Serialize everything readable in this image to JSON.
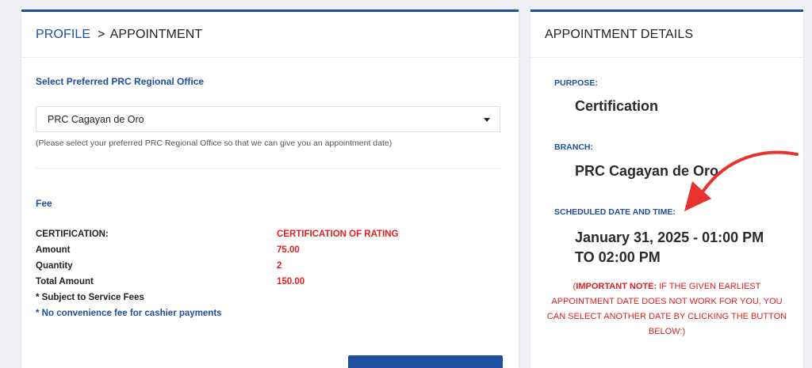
{
  "profile_card": {
    "breadcrumb": {
      "profile": "PROFILE",
      "separator": ">",
      "current": "APPOINTMENT"
    },
    "office_select": {
      "title": "Select Preferred PRC Regional Office",
      "selected": "PRC Cagayan de Oro",
      "help": "(Please select your preferred PRC Regional Office so that we can give you an appointment date)"
    },
    "fee": {
      "title": "Fee",
      "rows": [
        {
          "label": "CERTIFICATION:",
          "value": "CERTIFICATION OF RATING"
        },
        {
          "label": "Amount",
          "value": "75.00"
        },
        {
          "label": "Quantity",
          "value": "2"
        },
        {
          "label": "Total Amount",
          "value": "150.00"
        }
      ],
      "service_fee_note": "* Subject to Service Fees",
      "cashier_note": "* No convenience fee for cashier payments"
    }
  },
  "details_card": {
    "title": "APPOINTMENT DETAILS",
    "purpose_label": "PURPOSE:",
    "purpose_value": "Certification",
    "branch_label": "BRANCH:",
    "branch_value": "PRC Cagayan de Oro",
    "schedule_label": "SCHEDULED DATE AND TIME:",
    "schedule_value": "January 31, 2025 - 01:00 PM TO 02:00 PM",
    "note_prefix": "(",
    "note_bold": "IMPORTANT NOTE:",
    "note_text": " IF THE GIVEN EARLIEST APPOINTMENT DATE DOES NOT WORK FOR YOU, YOU CAN SELECT ANOTHER DATE BY CLICKING THE BUTTON BELOW:)"
  },
  "colors": {
    "accent_blue": "#1e4fa0",
    "alert_red": "#e0201f",
    "arrow_red": "#e8322f"
  },
  "icons": {
    "dropdown": "caret-down-icon",
    "annotation": "curved-arrow-icon"
  }
}
